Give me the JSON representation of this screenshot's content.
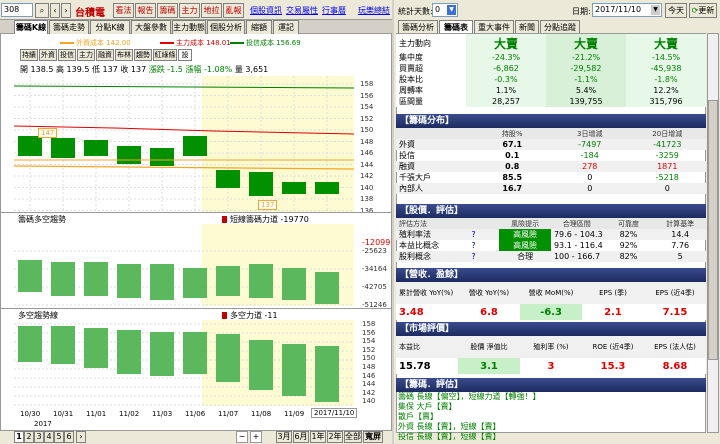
{
  "toolbar": {
    "code": "308",
    "stock_name": "台積電",
    "buttons": [
      "看法",
      "報告",
      "籌碼",
      "主力",
      "地拉",
      "亂報"
    ],
    "links": [
      "個股資訊",
      "交易屬性",
      "行事曆",
      "玩樂總結"
    ]
  },
  "left_tabs": [
    "籌碼K線",
    "籌碼走勢",
    "分點K線",
    "大盤參數",
    "主力動態",
    "個股分析",
    "縮額",
    "運記"
  ],
  "legend": {
    "cost1": "外資成本 142.00",
    "cost2": "主力成本 148.01",
    "cost3": "投信成本 156.69"
  },
  "chart_buttons": [
    "持績",
    "外資",
    "投信",
    "主力",
    "融資",
    "布林",
    "趨勢",
    "紅綠條",
    "設"
  ],
  "ohlc": {
    "open": "開 138.5",
    "high": "高 139.5",
    "low": "低 137",
    "close": "收 137",
    "change": "漲跌 -1.5",
    "pct": "漲幅 -1.08%",
    "vol": "量 3,651"
  },
  "main_chart": {
    "marker_147": "147",
    "marker_137": "137",
    "y_ticks": [
      "158",
      "156",
      "154",
      "152",
      "150",
      "148",
      "146",
      "144",
      "142",
      "140",
      "138",
      "136"
    ]
  },
  "panel2": {
    "title": "籌碼多空趨勢",
    "value_label": "短線籌碼力道 -19770",
    "right_value": "-12099",
    "y_ticks": [
      "-25623",
      "-34164",
      "-42705",
      "-51246"
    ]
  },
  "panel3": {
    "title": "多空趨勢線",
    "value_label": "多空力道 -11",
    "y_ticks": [
      "158",
      "156",
      "154",
      "152",
      "150",
      "148",
      "146",
      "144",
      "142",
      "140"
    ]
  },
  "x_dates": [
    "10/30",
    "10/31",
    "11/01",
    "11/02",
    "11/03",
    "11/06",
    "11/07",
    "11/08",
    "11/09",
    "2017/11/10"
  ],
  "year": "2017",
  "date_box": "2017/11/10",
  "bottom_pages": [
    "1",
    "2",
    "3",
    "4",
    "5",
    "6"
  ],
  "bottom_ranges": [
    "3月",
    "6月",
    "1年",
    "2年",
    "全部",
    "寬屏"
  ],
  "right_top": {
    "stat_days_label": "統計天數:",
    "stat_days": "0",
    "date_label": "日期:",
    "date": "2017/11/10",
    "today": "今天",
    "refresh": "更新"
  },
  "right_tabs": [
    "籌碼分析",
    "籌碼表",
    "重大事件",
    "新聞",
    "分點追蹤"
  ],
  "summary": {
    "cols": [
      "大賣",
      "大賣",
      "大賣"
    ],
    "rows": [
      {
        "label": "主力動向",
        "v": [
          "大賣",
          "大賣",
          "大賣"
        ]
      },
      {
        "label": "集中度",
        "v": [
          "-24.3%",
          "-21.2%",
          "-14.5%"
        ]
      },
      {
        "label": "買賣超",
        "v": [
          "-6,862",
          "-29,582",
          "-45,938"
        ]
      },
      {
        "label": "股本比",
        "v": [
          "-0.3%",
          "-1.1%",
          "-1.8%"
        ]
      },
      {
        "label": "周轉率",
        "v": [
          "1.1%",
          "5.4%",
          "12.2%"
        ]
      },
      {
        "label": "區間量",
        "v": [
          "28,257",
          "139,755",
          "315,796"
        ]
      }
    ]
  },
  "chip": {
    "title": "【籌碼分布】",
    "headers": [
      "",
      "持股%",
      "3日增減",
      "20日增減"
    ],
    "rows": [
      [
        "外資",
        "67.1",
        "-7497",
        "-41723"
      ],
      [
        "投信",
        "0.1",
        "-184",
        "-3259"
      ],
      [
        "融資",
        "0.8",
        "278",
        "1871"
      ],
      [
        "千張大戶",
        "85.5",
        "0",
        "-5218"
      ],
      [
        "內部人",
        "16.7",
        "0",
        "0"
      ]
    ]
  },
  "valuation": {
    "title": "【股價．評估】",
    "headers": [
      "評估方法",
      "",
      "風險提示",
      "合理區間",
      "可靠度",
      "計算基準"
    ],
    "rows": [
      [
        "殖利率法",
        "?",
        "高風險",
        "79.6 - 104.3",
        "82%",
        "14.4"
      ],
      [
        "本益比概念",
        "?",
        "高風險",
        "93.1 - 116.4",
        "92%",
        "7.76"
      ],
      [
        "股利概念",
        "?",
        "合理",
        "100 - 166.7",
        "82%",
        "5"
      ]
    ]
  },
  "revenue": {
    "title": "【營收．盈餘】",
    "headers": [
      "累計營收 YoY(%)",
      "營收 YoY(%)",
      "營收 MoM(%)",
      "EPS (季)",
      "EPS (近4季)"
    ],
    "values": [
      "3.48",
      "6.8",
      "-6.3",
      "2.1",
      "7.15"
    ]
  },
  "market": {
    "title": "【市場評價】",
    "headers": [
      "本益比",
      "股價 淨值比",
      "殖利率 (%)",
      "ROE (近4季)",
      "EPS (法人估)"
    ],
    "values": [
      "15.78",
      "3.1",
      "3",
      "15.3",
      "8.68"
    ]
  },
  "eval": {
    "title": "【籌碼．評估】",
    "lines": [
      "籌碼 長線【偏空】，短線力道【轉強！】",
      "集保 大戶【賣】",
      "散戶【賣】",
      "外資 長線【賣】，短線【賣】",
      "投信 長線【賣】，短線【賣】"
    ]
  },
  "colors": {
    "header_bg": "#1c2a60",
    "up": "#e00000",
    "down": "#008000",
    "candle": "#009000",
    "panel_bar": "#5cb85c"
  }
}
